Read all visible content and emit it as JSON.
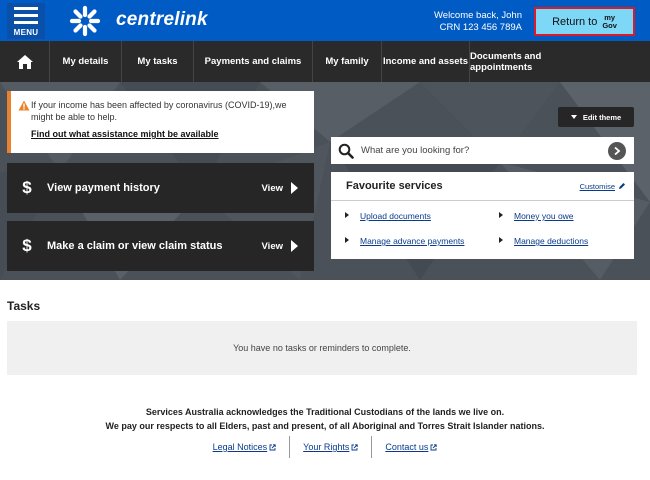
{
  "header": {
    "menu_label": "MENU",
    "brand": "centrelink",
    "welcome_line": "Welcome back, John",
    "crn_line": "CRN 123 456 789A",
    "return_label": "Return to",
    "mygov_top": "my",
    "mygov_bottom": "Gov",
    "colors": {
      "bar": "#005bc4",
      "return_bg": "#7dd7f7",
      "return_border": "#d91c2a"
    }
  },
  "nav": {
    "items": [
      {
        "label": "My details"
      },
      {
        "label": "My tasks"
      },
      {
        "label": "Payments and claims"
      },
      {
        "label": "My family"
      },
      {
        "label": "Income and assets"
      },
      {
        "label": "Documents and appointments"
      }
    ]
  },
  "alert": {
    "message": "If your income has been affected by coronavirus (COVID-19),we might be able to help.",
    "link": "Find out what assistance might be available",
    "accent": "#e8822e"
  },
  "actions": [
    {
      "title": "View payment history",
      "view": "View"
    },
    {
      "title": "Make a claim or view claim status",
      "view": "View"
    }
  ],
  "edit_theme": "Edit theme",
  "search": {
    "placeholder": "What are you looking for?"
  },
  "favourites": {
    "title": "Favourite services",
    "customise": "Customise",
    "links": [
      {
        "label": "Upload documents"
      },
      {
        "label": "Money you owe"
      },
      {
        "label": "Manage advance payments"
      },
      {
        "label": "Manage deductions"
      }
    ]
  },
  "tasks": {
    "title": "Tasks",
    "empty": "You have no tasks or reminders to complete."
  },
  "footer": {
    "ack_line1": "Services Australia acknowledges the Traditional Custodians of the lands we live on.",
    "ack_line2": "We pay our respects to all Elders, past and present, of all Aboriginal and Torres Strait Islander nations.",
    "links": [
      {
        "label": "Legal Notices"
      },
      {
        "label": "Your Rights"
      },
      {
        "label": "Contact us"
      }
    ]
  }
}
